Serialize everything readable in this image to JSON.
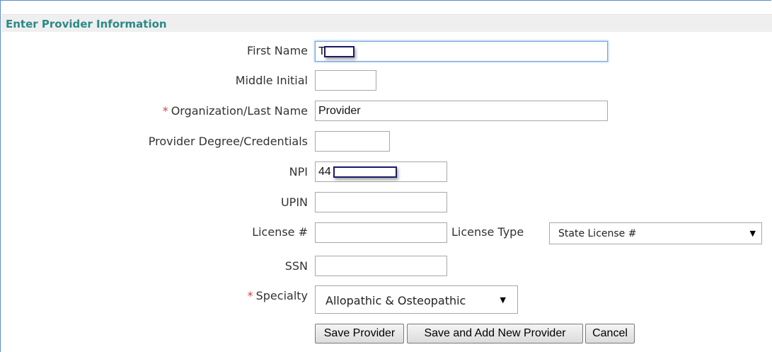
{
  "section": {
    "title": "Enter Provider Information"
  },
  "fields": {
    "first_name": {
      "label": "First Name",
      "value": "T"
    },
    "middle_initial": {
      "label": "Middle Initial",
      "value": ""
    },
    "org_last_name": {
      "required": "*",
      "label": "Organization/Last Name",
      "value": "Provider"
    },
    "degree": {
      "label": "Provider Degree/Credentials",
      "value": ""
    },
    "npi": {
      "label": "NPI",
      "value": "44"
    },
    "upin": {
      "label": "UPIN",
      "value": ""
    },
    "license_number": {
      "label": "License #",
      "value": ""
    },
    "license_type": {
      "label": "License Type",
      "value": "State License #"
    },
    "ssn": {
      "label": "SSN",
      "value": ""
    },
    "specialty": {
      "required": "*",
      "label": "Specialty",
      "value": "Allopathic & Osteopathic"
    }
  },
  "buttons": {
    "save": "Save Provider",
    "save_add": "Save and Add New Provider",
    "cancel": "Cancel"
  },
  "colors": {
    "header_text": "#2a8a86",
    "required": "#e23b3b",
    "frame_border": "#5b8fc4",
    "redaction_border": "#1b1a66"
  },
  "icons": {
    "dropdown": "triangle-down-icon"
  }
}
